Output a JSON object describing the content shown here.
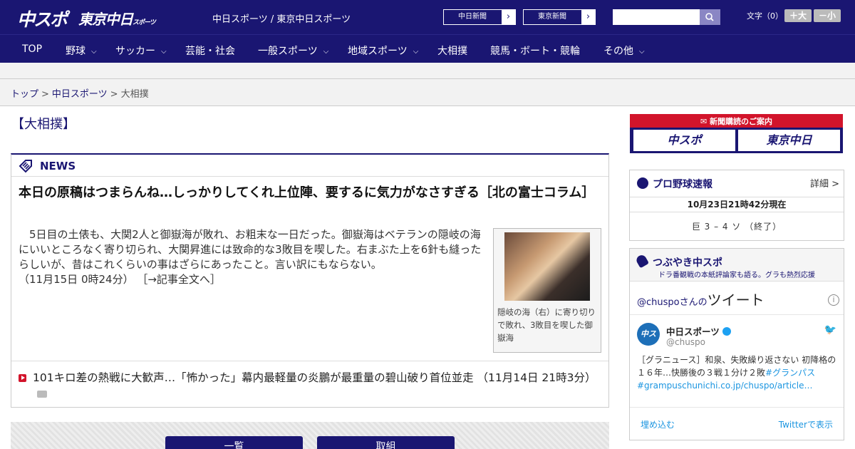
{
  "header": {
    "logo_main": "中スポ",
    "logo_tokyo": "東京中日",
    "logo_tokyo_small": "スポーツ",
    "site_names": "中日スポーツ / 東京中日スポーツ",
    "btn_chunichi": "中日新聞",
    "btn_tokyo": "東京新聞",
    "search_placeholder": "",
    "font_size_label": "文字（0）",
    "font_plus": "＋大",
    "font_minus": "－小"
  },
  "nav": {
    "items": [
      {
        "label": "TOP",
        "has_dropdown": false
      },
      {
        "label": "野球",
        "has_dropdown": true
      },
      {
        "label": "サッカー",
        "has_dropdown": true
      },
      {
        "label": "芸能・社会",
        "has_dropdown": false
      },
      {
        "label": "一般スポーツ",
        "has_dropdown": true
      },
      {
        "label": "地域スポーツ",
        "has_dropdown": true
      },
      {
        "label": "大相撲",
        "has_dropdown": false
      },
      {
        "label": "競馬・ボート・競輪",
        "has_dropdown": false
      },
      {
        "label": "その他",
        "has_dropdown": true
      }
    ]
  },
  "breadcrumb": {
    "top": "トップ",
    "section": "中日スポーツ",
    "current": "大相撲",
    "sep": ">"
  },
  "page": {
    "title": "【大相撲】"
  },
  "news": {
    "label": "NEWS",
    "main_title": "本日の原稿はつまらんね…しっかりしてくれ上位陣、要するに気力がなさすぎる［北の富士コラム］",
    "main_body": "5日目の土俵も、大関2人と御嶽海が敗れ、お粗末な一日だった。御嶽海はベテランの隠岐の海にいいところなく寄り切られ、大関昇進には致命的な3敗目を喫した。右まぶた上を6針も縫ったらしいが、昔はこれくらいの事はざらにあったこと。言い訳にもならない。",
    "main_time": "（11月15日 0時24分）",
    "main_link": "［→記事全文へ］",
    "photo_caption": "隠岐の海（右）に寄り切りで敗れ、3敗目を喫した御嶽海",
    "sub_title": "101キロ差の熱戦に大歓声…「怖かった」幕内最軽量の炎鵬が最重量の碧山破り首位並走",
    "sub_time": "（11月14日 21時3分）"
  },
  "bottom_buttons": {
    "left": "一覧",
    "right": "取組"
  },
  "sidebar": {
    "subscribe_title": "新聞購読のご案内",
    "subscribe_logo_a": "中スポ",
    "subscribe_logo_b": "東京中日",
    "baseball": {
      "title": "プロ野球速報",
      "detail": "詳細 >",
      "date": "10月23日21時42分現在",
      "score": "巨 3 – 4 ソ （終了）"
    },
    "tweets": {
      "title": "つぶやき中スポ",
      "subtitle": "ドラ番観戦の本紙評論家も語る。グラも熱烈応援",
      "head_user": "@chuspoさんの",
      "head_big": "ツイート",
      "name": "中日スポーツ",
      "handle": "@chuspo",
      "avatar": "中スポ",
      "text": "［グラニュース］和泉、失敗繰り返さない 初降格の１６年…快勝後の３戦１分け２敗",
      "hashtag": "#グランパス",
      "link": "#grampuschunichi.co.jp/chuspo/article…",
      "embed": "埋め込む",
      "view": "Twitterで表示"
    }
  },
  "colors": {
    "brand_navy": "#1a1672",
    "accent_red": "#d2142b",
    "twitter_blue": "#1b95e0"
  }
}
